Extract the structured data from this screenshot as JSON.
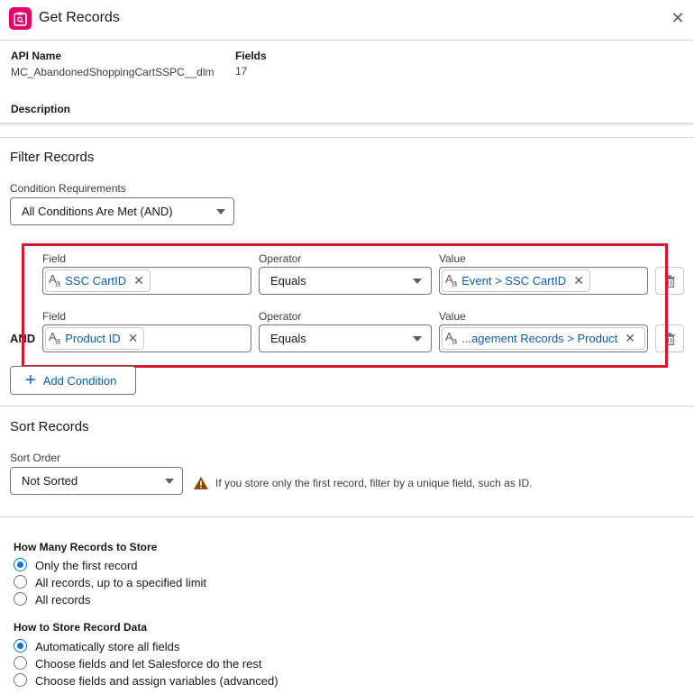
{
  "header": {
    "title": "Get Records",
    "close_symbol": "✕"
  },
  "info": {
    "api_name_label": "API Name",
    "api_name_value": "MC_AbandonedShoppingCartSSPC__dlm",
    "fields_label": "Fields",
    "fields_value": "17",
    "description_label": "Description"
  },
  "filter": {
    "section_title": "Filter Records",
    "condition_req_label": "Condition Requirements",
    "condition_req_value": "All Conditions Are Met (AND)",
    "conditions": [
      {
        "field_label": "Field",
        "field_value": "SSC CartID",
        "operator_label": "Operator",
        "operator_value": "Equals",
        "value_label": "Value",
        "value_value": "Event > SSC CartID"
      },
      {
        "field_label": "Field",
        "field_value": "Product ID",
        "operator_label": "Operator",
        "operator_value": "Equals",
        "value_label": "Value",
        "value_value": "...agement Records > Product"
      }
    ],
    "and_label": "AND",
    "add_condition_label": "Add Condition"
  },
  "sort": {
    "section_title": "Sort Records",
    "order_label": "Sort Order",
    "order_value": "Not Sorted",
    "warning_text": "If you store only the first record, filter by a unique field, such as ID."
  },
  "store_count": {
    "title": "How Many Records to Store",
    "options": [
      "Only the first record",
      "All records, up to a specified limit",
      "All records"
    ],
    "selected_index": 0
  },
  "store_data": {
    "title": "How to Store Record Data",
    "options": [
      "Automatically store all fields",
      "Choose fields and let Salesforce do the rest",
      "Choose fields and assign variables (advanced)"
    ],
    "selected_index": 0
  },
  "colors": {
    "accent": "#0176d3",
    "link": "#0b5cab",
    "highlight": "#d6162a",
    "brand_icon": "#e3066a"
  }
}
